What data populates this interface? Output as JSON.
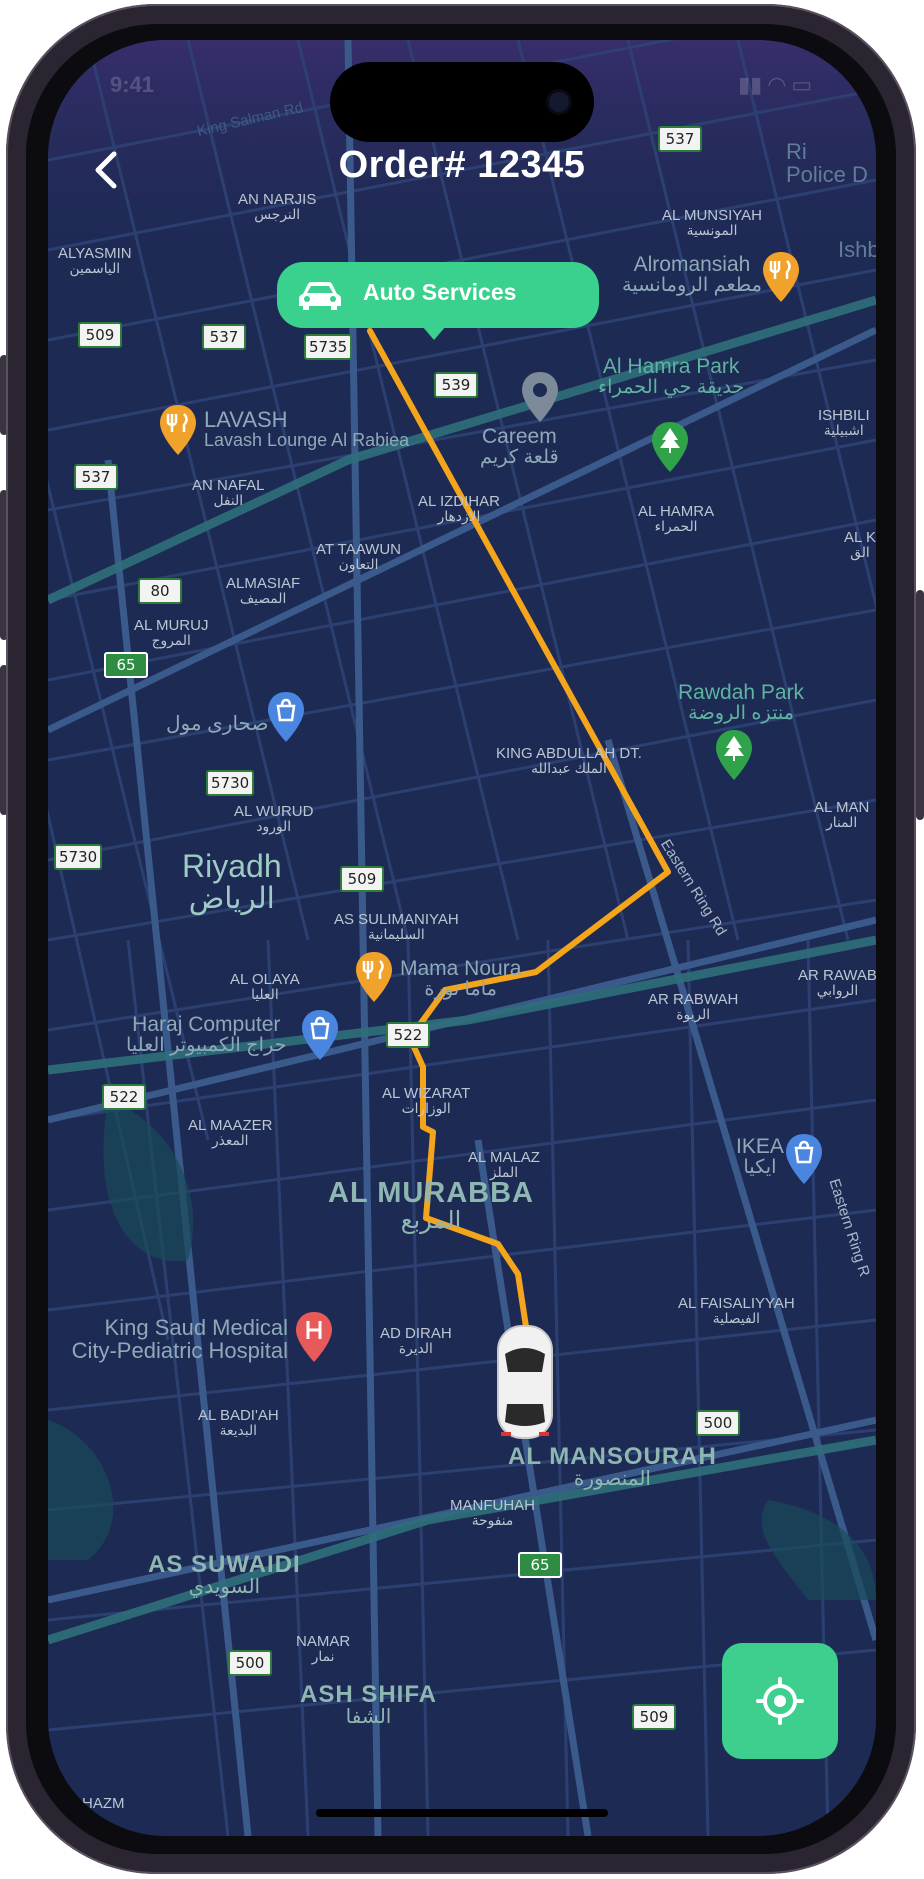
{
  "header": {
    "title": "Order# 12345",
    "back_icon": "chevron-left-icon"
  },
  "status_bar": {
    "time": "9:41"
  },
  "tooltip": {
    "label": "Auto Services",
    "icon": "car-icon",
    "color": "#3ad08e"
  },
  "locate_button": {
    "icon": "crosshair-icon",
    "color": "#3ecf8e"
  },
  "route": {
    "color": "#f4a51b"
  },
  "map": {
    "labels": {
      "king_salman": "King Salman Rd",
      "police": "Police D",
      "ri": "Ri",
      "ishb": "Ishb",
      "an_narjis_en": "AN NARJIS",
      "an_narjis_ar": "النرجس",
      "alyasmin_en": "ALYASMIN",
      "alyasmin_ar": "الياسمين",
      "al_munsiyah_en": "AL MUNSIYAH",
      "al_munsiyah_ar": "المونسية",
      "alromansiah_en": "Alromansiah",
      "alromansiah_ar": "مطعم الرومانسية",
      "lavash_en": "LAVASH",
      "lavash_sub": "Lavash Lounge Al Rabiea",
      "al_hamra_park_en": "Al Hamra Park",
      "al_hamra_park_ar": "حديقة حي الحمراء",
      "careem_en": "Careem",
      "careem_ar": "قلعة كريم",
      "ishbili": "ISHBILI",
      "ishbili_ar": "اشبيلية",
      "an_nafal_en": "AN NAFAL",
      "an_nafal_ar": "النفل",
      "al_izdihar_en": "AL IZDIHAR",
      "al_izdihar_ar": "الازدهار",
      "al_hamra_en": "AL HAMRA",
      "al_hamra_ar": "الحمراء",
      "at_taawun_en": "AT TAAWUN",
      "at_taawun_ar": "التعاون",
      "al_k": "AL K",
      "al_k_ar": "الق",
      "almasiaf_en": "ALMASIAF",
      "almasiaf_ar": "المصيف",
      "al_muruj_en": "AL MURUJ",
      "al_muruj_ar": "المروج",
      "rawdah_park_en": "Rawdah Park",
      "rawdah_park_ar": "منتزه الروضة",
      "sahara_mall": "صحارى مول",
      "king_abdullah_en": "KING ABDULLAH DT.",
      "king_abdullah_ar": "الملك عبدالله",
      "al_wurud_en": "AL WURUD",
      "al_wurud_ar": "الورود",
      "al_manar_en": "AL MAN",
      "al_manar_ar": "المنار",
      "riyadh_en": "Riyadh",
      "riyadh_ar": "الرياض",
      "eastern_ring": "Eastern Ring Rd",
      "eastern_ring_2": "Eastern Ring R",
      "as_sulimaniyah_en": "AS SULIMANIYAH",
      "as_sulimaniyah_ar": "السليمانية",
      "mama_noura_en": "Mama Noura",
      "mama_noura_ar": "ماما نورة",
      "ar_rawab_en": "AR RAWAB",
      "ar_rawab_ar": "الروابي",
      "al_olaya_en": "AL OLAYA",
      "al_olaya_ar": "العليا",
      "ar_rabwah_en": "AR RABWAH",
      "ar_rabwah_ar": "الربوة",
      "haraj_en": "Haraj Computer",
      "haraj_ar": "حراج الكمبيوتر العليا",
      "al_wizarat_en": "AL WIZARAT",
      "al_wizarat_ar": "الوزارات",
      "al_maazer_en": "AL MAAZER",
      "al_maazer_ar": "المعذر",
      "ikea_en": "IKEA",
      "ikea_ar": "ايكيا",
      "al_malaz_en": "AL MALAZ",
      "al_malaz_ar": "الملز",
      "al_murabba_en": "AL MURABBA",
      "al_murabba_ar": "المربع",
      "al_faisaliyyah_en": "AL FAISALIYYAH",
      "al_faisaliyyah_ar": "الفيصلية",
      "king_saud_en": "King Saud Medical",
      "king_saud_en2": "City-Pediatric Hospital",
      "ad_dirah_en": "AD DIRAH",
      "ad_dirah_ar": "الديرة",
      "al_badiah_en": "AL BADI'AH",
      "al_badiah_ar": "البديعة",
      "al_mansourah_en": "AL MANSOURAH",
      "al_mansourah_ar": "المنصورة",
      "manfuhah_en": "MANFUHAH",
      "manfuhah_ar": "منفوحة",
      "as_suwaidi_en": "AS SUWAIDI",
      "as_suwaidi_ar": "السويدي",
      "namar_en": "NAMAR",
      "namar_ar": "نمار",
      "ash_shifa_en": "ASH SHIFA",
      "ash_shifa_ar": "الشفا",
      "hazm": "HAZM"
    },
    "road_shields": {
      "s537a": "537",
      "s509a": "509",
      "s537b": "537",
      "s5735": "5735",
      "s539": "539",
      "s537c": "537",
      "s80": "80",
      "s65a": "65",
      "s5730a": "5730",
      "s5730b": "5730",
      "s509b": "509",
      "s522a": "522",
      "s522b": "522",
      "s500a": "500",
      "s65b": "65",
      "s500b": "500",
      "s509c": "509"
    }
  }
}
